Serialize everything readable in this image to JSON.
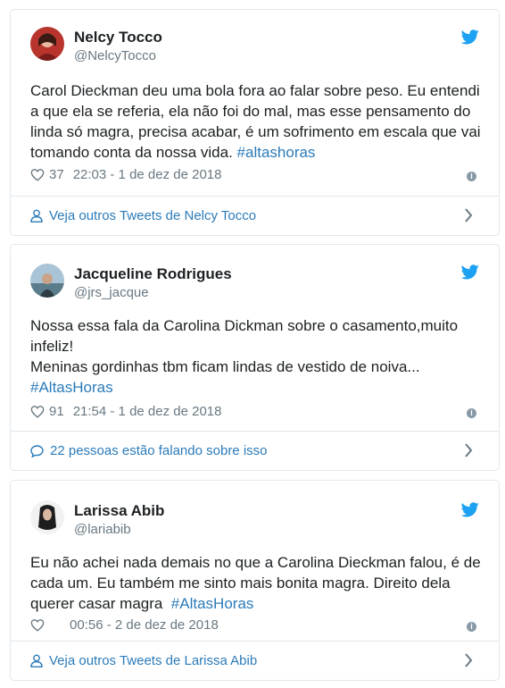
{
  "tweets": [
    {
      "name": "Nelcy Tocco",
      "handle": "@NelcyTocco",
      "text": "Carol Dieckman deu uma bola fora ao falar sobre peso. Eu entendi a que ela se referia, ela não foi do mal, mas esse pensamento do linda só magra, precisa acabar, é um sofrimento em escala que vai tomando conta da nossa vida. ",
      "hashtag": "#altashoras",
      "likes": "37",
      "time": "22:03 - 1 de dez de 2018",
      "footer_icon": "person-icon",
      "footer": "Veja outros Tweets de Nelcy Tocco"
    },
    {
      "name": "Jacqueline Rodrigues",
      "handle": "@jrs_jacque",
      "text": "Nossa essa fala da Carolina Dickman sobre o casamento,muito infeliz!\nMeninas gordinhas tbm ficam lindas de vestido de noiva...\n",
      "hashtag": "#AltasHoras",
      "likes": "91",
      "time": "21:54 - 1 de dez de 2018",
      "footer_icon": "speech-bubble-icon",
      "footer": "22 pessoas estão falando sobre isso"
    },
    {
      "name": "Larissa Abib",
      "handle": "@lariabib",
      "text": "Eu não achei nada demais no que a Carolina Dieckman falou, é de cada um. Eu também me sinto mais bonita magra. Direito dela querer casar magra  ",
      "hashtag": "#AltasHoras",
      "likes": "",
      "time": "00:56 - 2 de dez de 2018",
      "footer_icon": "person-icon",
      "footer": "Veja outros Tweets de Larissa Abib"
    }
  ],
  "colors": {
    "link": "#2b7bb9",
    "muted": "#697882",
    "border": "#e1e8ed",
    "twitter_blue": "#1da1f2"
  }
}
